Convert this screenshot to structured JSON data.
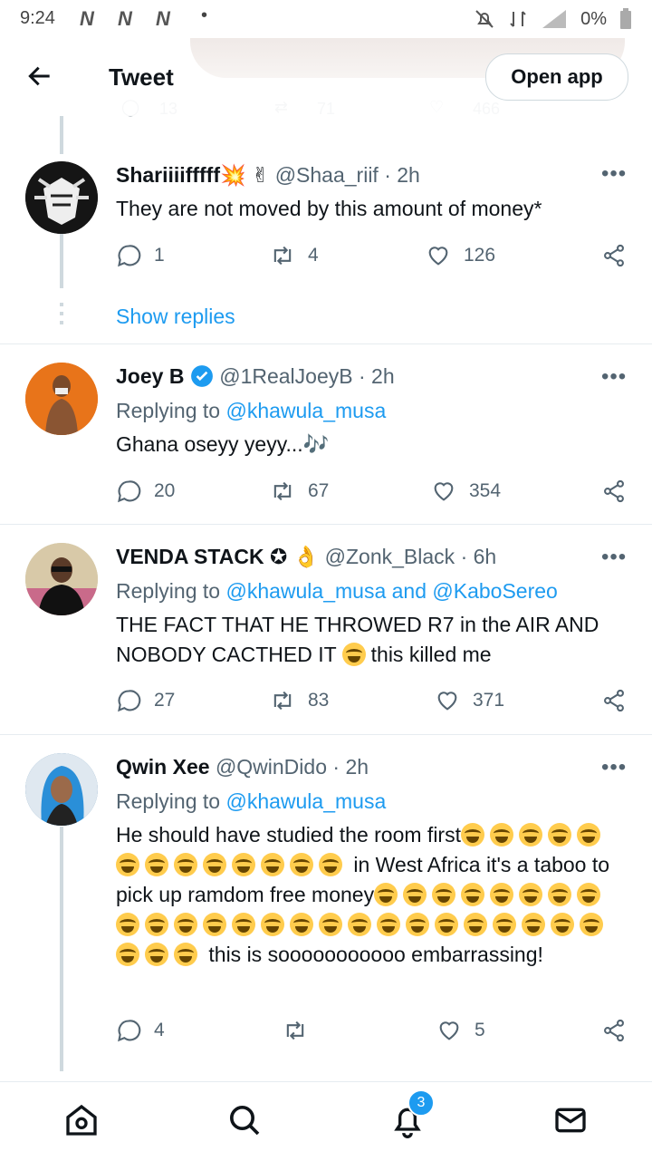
{
  "status": {
    "time": "9:24",
    "network_icons": "N N N",
    "dot": "•",
    "battery": "0%"
  },
  "header": {
    "title": "Tweet",
    "open_app": "Open app"
  },
  "prev_stats": {
    "replies": "13",
    "retweets": "71",
    "likes": "466"
  },
  "tweets": [
    {
      "name": "Shariiiifffff",
      "emoji": "💥 ✌",
      "handle": "@Shaa_riif",
      "time": "· 2h",
      "text": "They are not moved by this amount of money*",
      "replies": "1",
      "retweets": "4",
      "likes": "126"
    },
    {
      "name": "Joey B",
      "handle": "@1RealJoeyB",
      "time": "· 2h",
      "replying": "Replying to",
      "mention1": "@khawula_musa",
      "text": "Ghana oseyy yeyy...🎶",
      "replies": "20",
      "retweets": "67",
      "likes": "354"
    },
    {
      "name": "VENDA STACK",
      "emoji": "✪ 👌",
      "handle": "@Zonk_Black",
      "time": "· 6h",
      "replying": "Replying to",
      "mention1": "@khawula_musa",
      "and": "and",
      "mention2": "@KaboSereo",
      "text_a": "THE FACT THAT HE THROWED R7 in the AIR AND NOBODY CACTHED IT",
      "text_b": "this killed me",
      "replies": "27",
      "retweets": "83",
      "likes": "371"
    },
    {
      "name": "Qwin Xee",
      "handle": "@QwinDido",
      "time": "· 2h",
      "replying": "Replying to",
      "mention1": "@khawula_musa",
      "text_a": "He should have studied the room first",
      "text_b": "in West Africa it's a taboo to pick up ramdom free money",
      "text_c": "this is sooooooooooo embarrassing!",
      "replies": "4",
      "likes": "5"
    }
  ],
  "show_replies": "Show replies",
  "nav": {
    "badge": "3"
  },
  "colors": {
    "accent": "#1d9bf0",
    "text": "#0f1419",
    "muted": "#536471"
  }
}
